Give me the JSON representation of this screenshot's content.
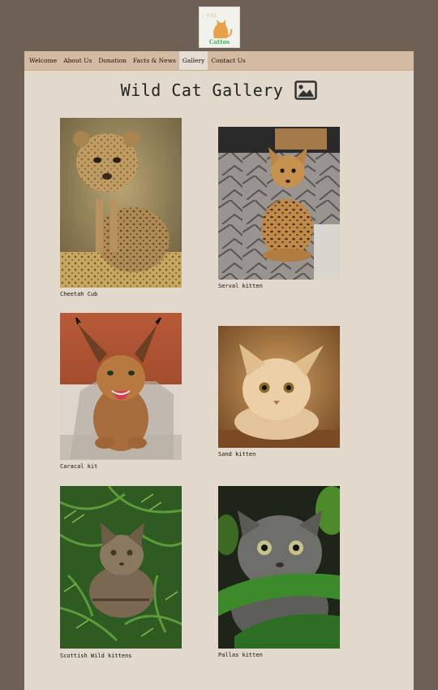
{
  "logo": {
    "text": "Cattos"
  },
  "nav": {
    "items": [
      {
        "label": "Welcome"
      },
      {
        "label": "About Us"
      },
      {
        "label": "Donation"
      },
      {
        "label": "Facts & News"
      },
      {
        "label": "Gallery",
        "active": true
      },
      {
        "label": "Contact Us"
      }
    ]
  },
  "page": {
    "title": "Wild Cat Gallery",
    "title_icon": "image-icon"
  },
  "gallery": {
    "items": [
      {
        "caption": "Cheetah Cub",
        "icon": "cheetah-cub-photo"
      },
      {
        "caption": "Serval kitten",
        "icon": "serval-kitten-photo"
      },
      {
        "caption": "Caracal kit",
        "icon": "caracal-kit-photo"
      },
      {
        "caption": "Sand kitten",
        "icon": "sand-kitten-photo"
      },
      {
        "caption": "Scottish Wild kittens",
        "icon": "scottish-wild-kittens-photo"
      },
      {
        "caption": "Pallas kitten",
        "icon": "pallas-kitten-photo"
      }
    ]
  },
  "colors": {
    "outer_background": "#6f6055",
    "page_background": "#e2d8cb",
    "nav_background": "#d4baa0",
    "nav_active": "#e8ddd2",
    "logo_orange": "#e8a04a",
    "logo_green": "#3fb65a"
  }
}
